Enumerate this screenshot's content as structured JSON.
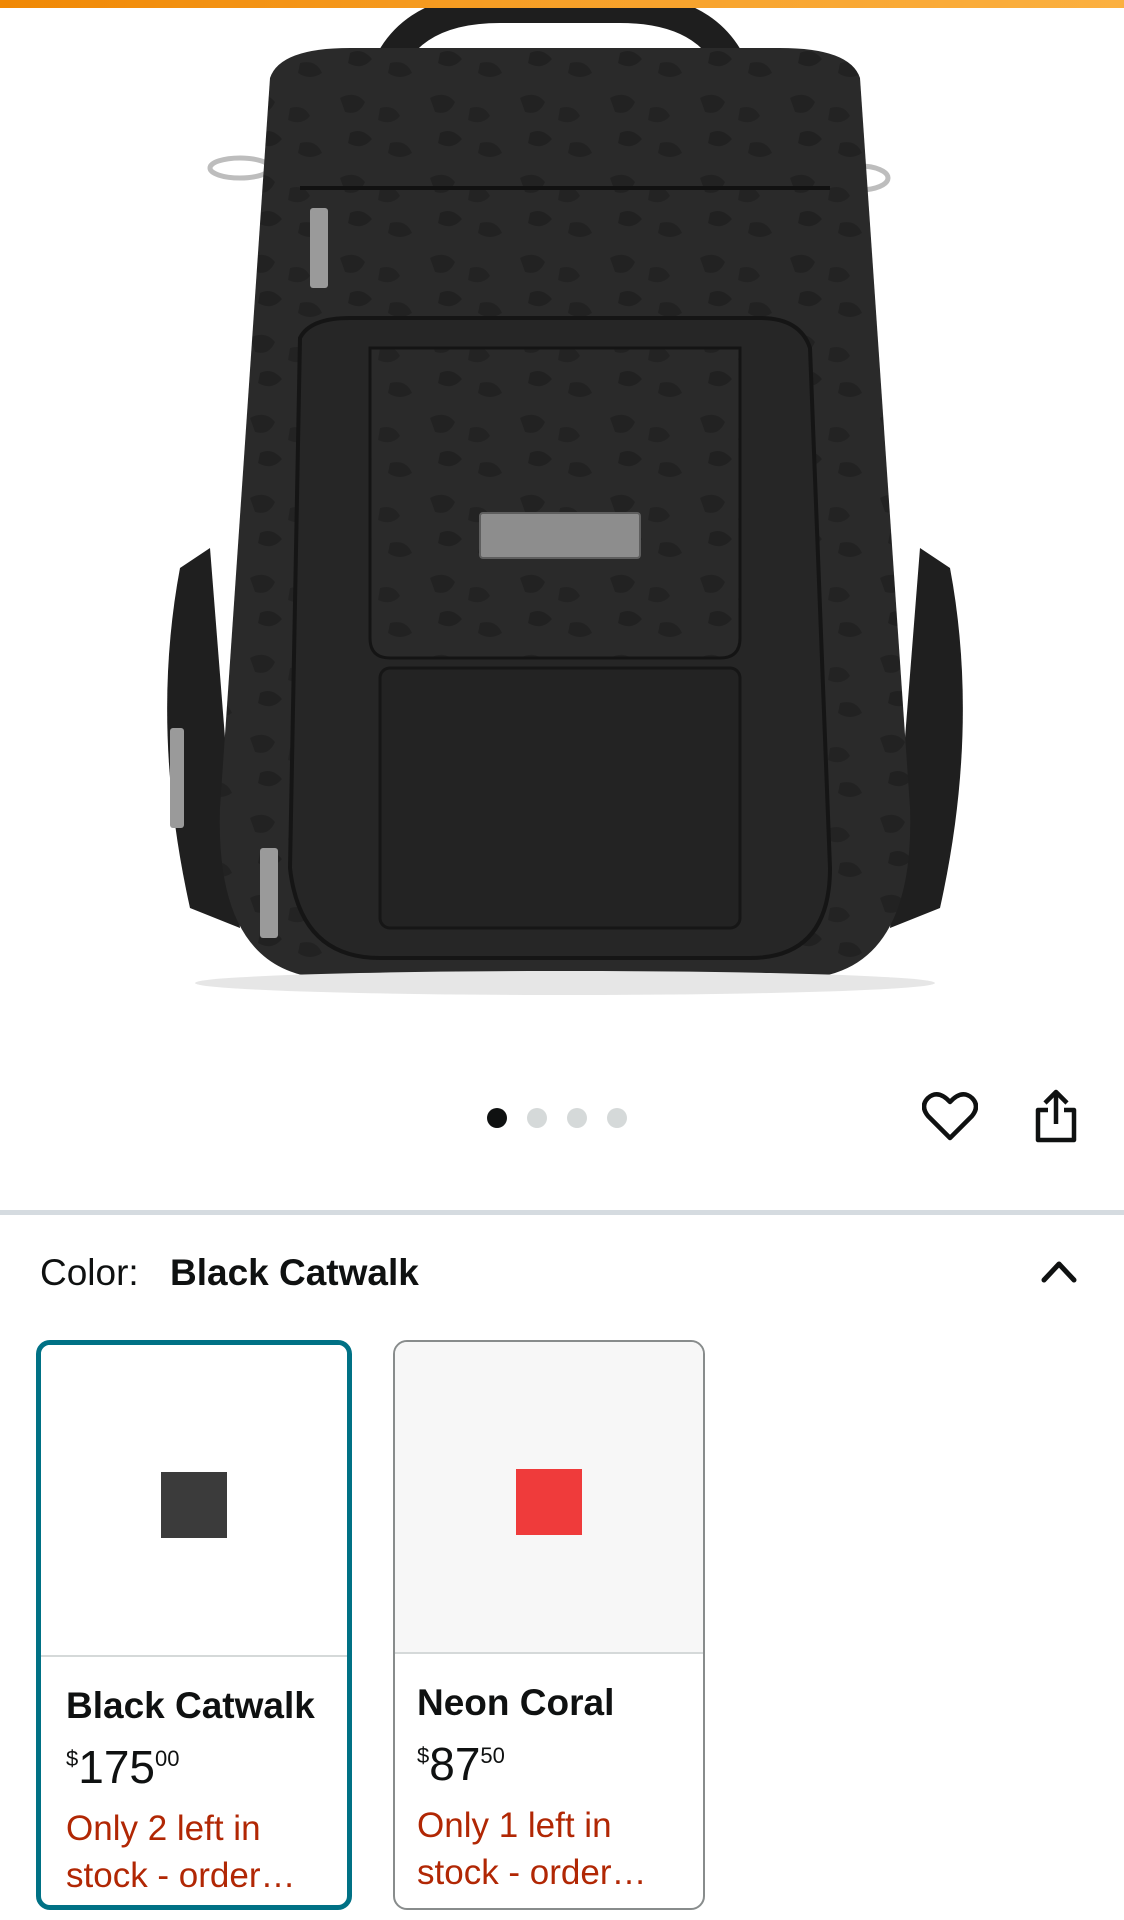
{
  "gallery": {
    "image_alt": "Black Catwalk backpack",
    "image_count": 4,
    "active_index": 0
  },
  "actions": {
    "favorite_icon": "heart-icon",
    "share_icon": "share-icon"
  },
  "variation": {
    "label": "Color:",
    "selected_value": "Black Catwalk",
    "toggle_icon": "chevron-up-icon"
  },
  "swatches": [
    {
      "name": "Black Catwalk",
      "price_symbol": "$",
      "price_whole": "175",
      "price_fraction": "00",
      "stock": "Only 2 left in stock - order…",
      "chip_color": "#3b3b3b",
      "selected": true
    },
    {
      "name": "Neon Coral",
      "price_symbol": "$",
      "price_whole": "87",
      "price_fraction": "50",
      "stock": "Only 1 left in stock - order…",
      "chip_color": "#ef3b3b",
      "selected": false
    }
  ],
  "colors": {
    "brand_bar": "#f08804",
    "selected_border": "#007185",
    "stock_text": "#b12704"
  }
}
